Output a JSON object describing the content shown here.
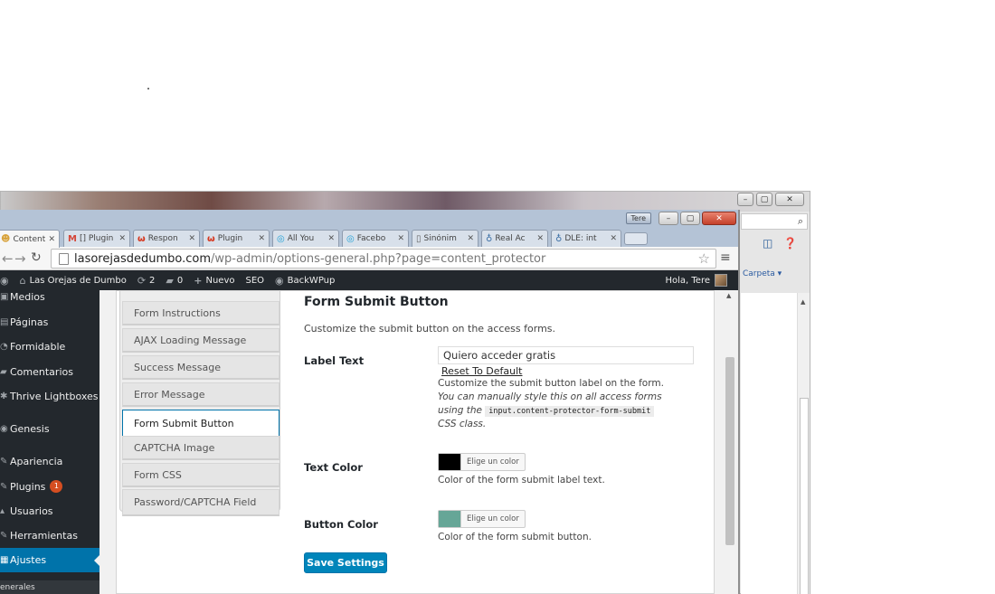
{
  "back_window": {
    "carpeta_label": "Carpeta ▾",
    "search_icon": "⌕",
    "controls": [
      "–",
      "▢",
      "✕"
    ]
  },
  "window": {
    "user_badge": "Tere",
    "controls": [
      "–",
      "▢",
      "✕"
    ]
  },
  "tabs": [
    {
      "icon": "wp",
      "label": "Content",
      "color": "#d8a23a"
    },
    {
      "icon": "M",
      "label": "[] Plugin",
      "color": "#d44638"
    },
    {
      "icon": "w",
      "label": "Respon",
      "color": "#d6361d"
    },
    {
      "icon": "w",
      "label": "Plugin",
      "color": "#d6361d"
    },
    {
      "icon": "c",
      "label": "All You",
      "color": "#1fa0d6"
    },
    {
      "icon": "c",
      "label": "Facebo",
      "color": "#1fa0d6"
    },
    {
      "icon": "doc",
      "label": "Sinónim",
      "color": "#666666"
    },
    {
      "icon": "img",
      "label": "Real Ac",
      "color": "#3a6ea5"
    },
    {
      "icon": "img",
      "label": "DLE: int",
      "color": "#3a6ea5"
    }
  ],
  "address_bar": {
    "host": "lasorejasdedumbo.com",
    "path": "/wp-admin/options-general.php?page=content_protector"
  },
  "admin_bar": {
    "site_name": "Las Orejas de Dumbo",
    "updates": "2",
    "comments": "0",
    "new_label": "Nuevo",
    "seo_label": "SEO",
    "backwpup_label": "BackWPup",
    "greeting": "Hola, Tere"
  },
  "sidebar": {
    "items": [
      {
        "label": "Medios",
        "icon": "▣"
      },
      {
        "label": "Páginas",
        "icon": "▤"
      },
      {
        "label": "Formidable",
        "icon": "◔"
      },
      {
        "label": "Comentarios",
        "icon": "▰"
      },
      {
        "label": "Thrive Lightboxes",
        "icon": "✱"
      },
      {
        "label": "Genesis",
        "icon": "◉"
      },
      {
        "label": "Apariencia",
        "icon": "✎"
      },
      {
        "label": "Plugins",
        "icon": "✎",
        "badge": "1"
      },
      {
        "label": "Usuarios",
        "icon": "▴"
      },
      {
        "label": "Herramientas",
        "icon": "✎"
      },
      {
        "label": "Ajustes",
        "icon": "▦",
        "active": true
      }
    ],
    "submenu_label": "enerales"
  },
  "settings_tabs": [
    "Form Instructions",
    "AJAX Loading Message",
    "Success Message",
    "Error Message",
    "Form Submit Button",
    "CAPTCHA Image",
    "Form CSS",
    "Password/CAPTCHA Field"
  ],
  "active_settings_tab": "Form Submit Button",
  "section": {
    "title": "Form Submit Button",
    "description": "Customize the submit button on the access forms.",
    "label_text": {
      "label": "Label Text",
      "value": "Quiero acceder gratis",
      "reset_link": "Reset To Default",
      "help_line1": "Customize the submit button label on the form.",
      "help_line2": "You can manually style this on all access forms",
      "help_line3_prefix": "using the",
      "help_code": "input.content-protector-form-submit",
      "help_line4": "CSS class."
    },
    "text_color": {
      "label": "Text Color",
      "swatch": "#000000",
      "picker_label": "Elige un color",
      "help": "Color of the form submit label text."
    },
    "button_color": {
      "label": "Button Color",
      "swatch": "#66a697",
      "picker_label": "Elige un color",
      "help": "Color of the form submit button."
    },
    "save_label": "Save Settings"
  }
}
